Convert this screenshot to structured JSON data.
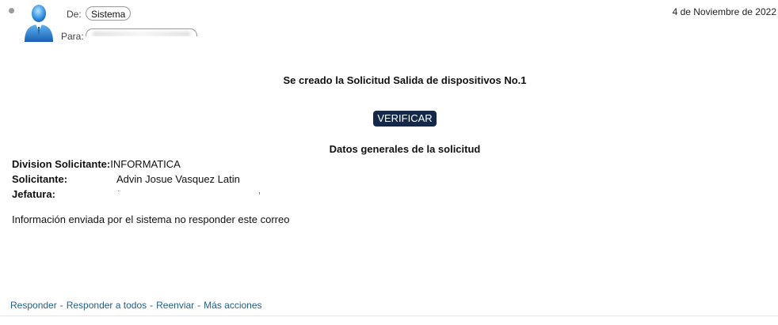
{
  "header": {
    "from_label": "De:",
    "from_value": "Sistema",
    "to_label": "Para:",
    "to_value": "",
    "date": "4 de Noviembre de 2022"
  },
  "email": {
    "title": "Se creado la Solicitud Salida de dispositivos No.1",
    "verify_button": "VERIFICAR",
    "section_title": "Datos generales de la solicitud",
    "fields": [
      {
        "label": "Division Solicitante:",
        "value": "INFORMATICA"
      },
      {
        "label": "Solicitante:",
        "value": "Advin Josue Vasquez Latin"
      },
      {
        "label": "Jefatura:",
        "value": ""
      }
    ],
    "footer_note": "Información enviada por el sistema no responder este correo"
  },
  "actions": {
    "reply": "Responder",
    "reply_all": "Responder a todos",
    "forward": "Reenviar",
    "more": "Más acciones",
    "separator": "-"
  },
  "colors": {
    "button_bg": "#14294a",
    "link": "#1f5f8b",
    "avatar_blue": "#2d7fd0"
  }
}
